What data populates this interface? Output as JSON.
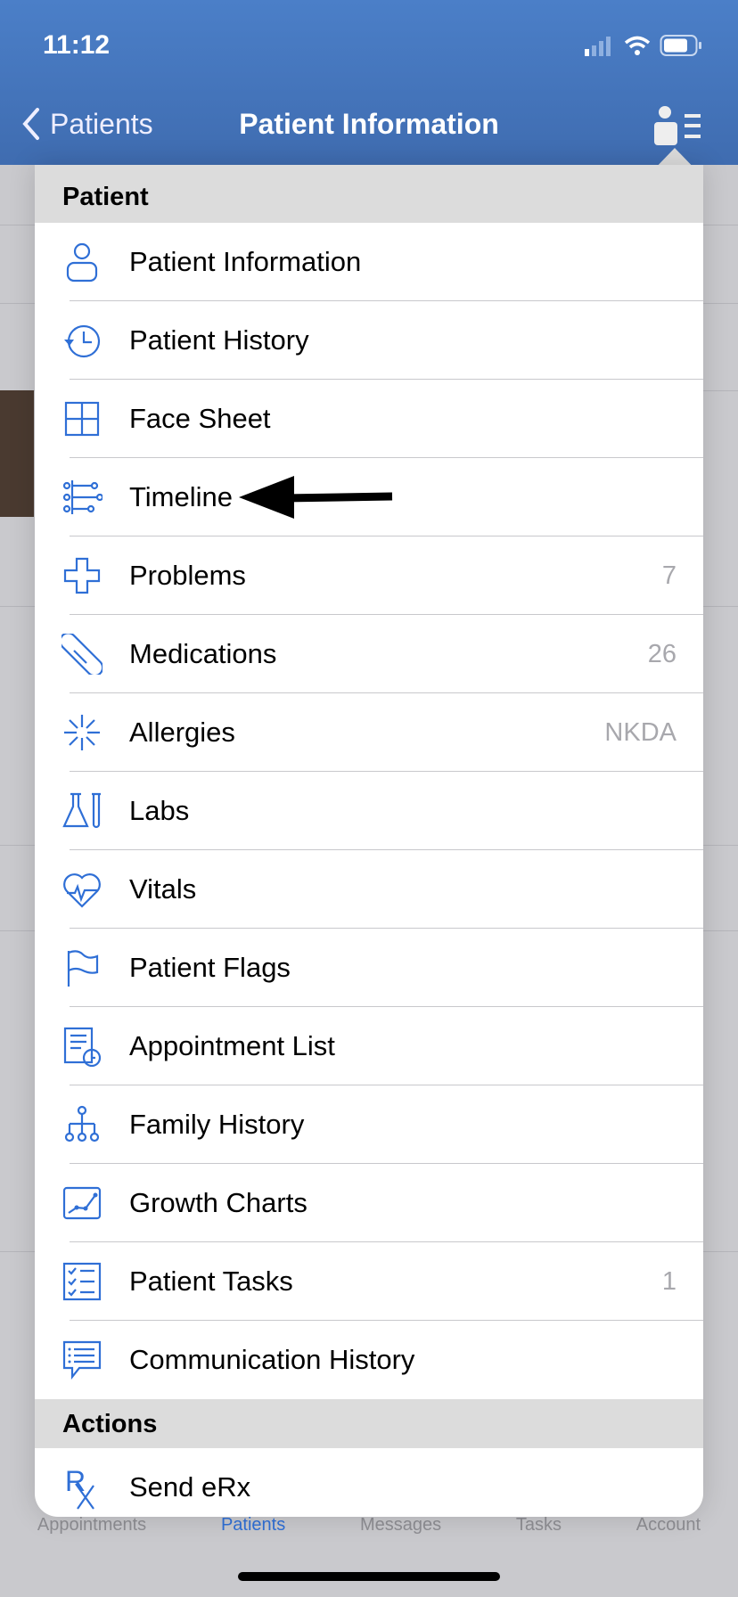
{
  "status_bar": {
    "time": "11:12"
  },
  "nav": {
    "back_label": "Patients",
    "title": "Patient Information"
  },
  "menu": {
    "section_patient": "Patient",
    "items": [
      {
        "label": "Patient Information",
        "icon": "person-icon",
        "count": ""
      },
      {
        "label": "Patient History",
        "icon": "history-icon",
        "count": ""
      },
      {
        "label": "Face Sheet",
        "icon": "grid-icon",
        "count": ""
      },
      {
        "label": "Timeline",
        "icon": "timeline-icon",
        "count": ""
      },
      {
        "label": "Problems",
        "icon": "cross-icon",
        "count": "7"
      },
      {
        "label": "Medications",
        "icon": "pill-icon",
        "count": "26"
      },
      {
        "label": "Allergies",
        "icon": "allergy-icon",
        "count": "NKDA"
      },
      {
        "label": "Labs",
        "icon": "flask-icon",
        "count": ""
      },
      {
        "label": "Vitals",
        "icon": "heart-pulse-icon",
        "count": ""
      },
      {
        "label": "Patient Flags",
        "icon": "flag-icon",
        "count": ""
      },
      {
        "label": "Appointment List",
        "icon": "appointment-list-icon",
        "count": ""
      },
      {
        "label": "Family History",
        "icon": "family-tree-icon",
        "count": ""
      },
      {
        "label": "Growth Charts",
        "icon": "growth-chart-icon",
        "count": ""
      },
      {
        "label": "Patient Tasks",
        "icon": "checklist-icon",
        "count": "1"
      },
      {
        "label": "Communication History",
        "icon": "chat-list-icon",
        "count": ""
      }
    ],
    "section_actions": "Actions",
    "actions": [
      {
        "label": "Send eRx",
        "icon": "rx-icon"
      }
    ]
  },
  "tabs": [
    "Appointments",
    "Patients",
    "Messages",
    "Tasks",
    "Account"
  ],
  "colors": {
    "nav": "#4577be",
    "accent": "#2f6fd6"
  }
}
